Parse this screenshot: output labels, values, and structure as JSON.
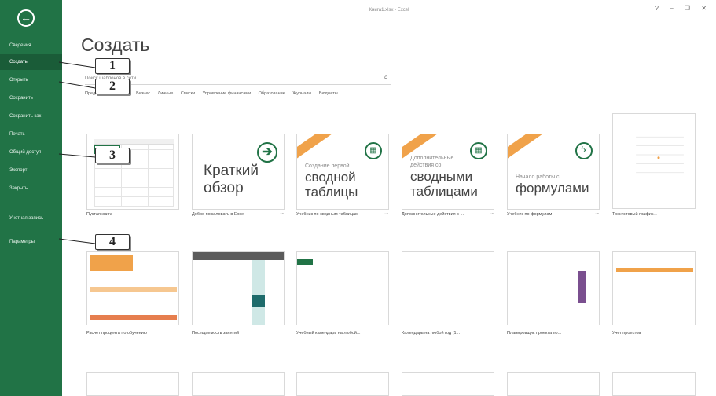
{
  "window": {
    "title": "Книга1.xlsx - Excel",
    "controls": "? – ❐ ✕"
  },
  "sidebar": {
    "back_icon": "back-arrow-icon",
    "items": [
      {
        "label": "Сведения"
      },
      {
        "label": "Создать"
      },
      {
        "label": "Открыть"
      },
      {
        "label": "Сохранить"
      },
      {
        "label": "Сохранить как"
      },
      {
        "label": "Печать"
      },
      {
        "label": "Общий доступ"
      },
      {
        "label": "Экспорт"
      },
      {
        "label": "Закрыть"
      },
      {
        "label": "Учетная запись"
      },
      {
        "label": "Параметры"
      }
    ]
  },
  "main": {
    "title": "Создать",
    "search": {
      "placeholder": "Поиск шаблонов в сети"
    },
    "suggested_label": "Предлагаемый поиск:",
    "suggested": [
      "Бизнес",
      "Личные",
      "Списки",
      "Управление финансами",
      "Образование",
      "Журналы",
      "Бюджеты"
    ]
  },
  "templates_row1": [
    {
      "caption": "Пустая книга",
      "icon": "blank-sheet"
    },
    {
      "caption": "Добро пожаловать в Excel",
      "lines": [
        "Краткий",
        "обзор"
      ]
    },
    {
      "caption": "Учебник по сводным таблицам",
      "small": [
        "Создание первой"
      ],
      "lines": [
        "сводной",
        "таблицы"
      ]
    },
    {
      "caption": "Дополнительные действия с ...",
      "small": [
        "Дополнительные",
        "действия со"
      ],
      "lines": [
        "сводными",
        "таблицами"
      ]
    },
    {
      "caption": "Учебник по формулам",
      "small": [
        "Начало работы с"
      ],
      "lines": [
        "формулами"
      ]
    },
    {
      "caption": "Трекинговый график..."
    }
  ],
  "templates_row2": [
    {
      "caption": "Расчет процента по обучению"
    },
    {
      "caption": "Посещаемость занятий"
    },
    {
      "caption": "Учебный календарь на любой..."
    },
    {
      "caption": "Календарь на любой год (1..."
    },
    {
      "caption": "Планировщик проекта по..."
    },
    {
      "caption": "Учет проектов"
    }
  ],
  "callouts": [
    "1",
    "2",
    "3",
    "4"
  ],
  "colors": {
    "accent": "#217346",
    "ribbon": "#f0a24a"
  }
}
